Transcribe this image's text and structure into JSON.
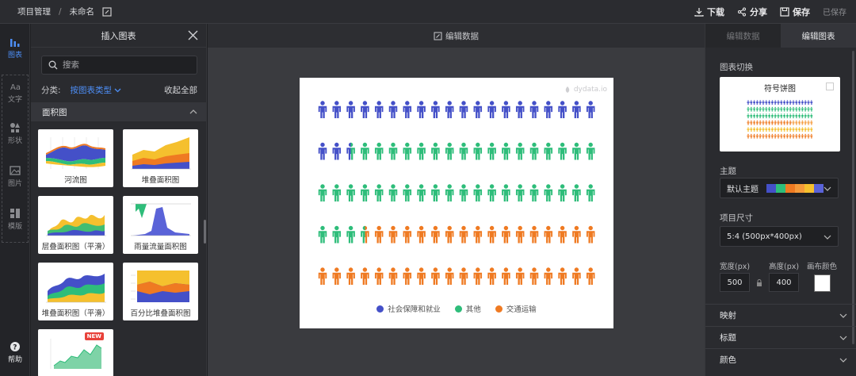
{
  "breadcrumb": {
    "project": "项目管理",
    "separator": "/",
    "name": "未命名"
  },
  "topbar": {
    "download": "下载",
    "share": "分享",
    "save": "保存",
    "saved_status": "已保存"
  },
  "rail": {
    "items": [
      "图表",
      "文字",
      "形状",
      "图片",
      "模版"
    ],
    "help": "帮助"
  },
  "insert_panel": {
    "title": "插入图表",
    "search_placeholder": "搜索",
    "filter_label": "分类:",
    "filter_value": "按图表类型",
    "collapse_all": "收起全部",
    "section": "面积图",
    "cards": [
      "河流图",
      "堆叠面积图",
      "层叠面积图（平滑）",
      "雨量流量面积图",
      "堆叠面积图（平滑）",
      "百分比堆叠面积图",
      ""
    ],
    "new_badge": "NEW"
  },
  "canvas": {
    "edit_data": "编辑数据",
    "watermark": "dydata.io"
  },
  "chart_data": {
    "type": "pictorial",
    "icon": "person-icon",
    "rows": 5,
    "icons_per_row": 20,
    "total_icons": 100,
    "series": [
      {
        "name": "社会保障和就业",
        "count": 22.5,
        "color": "#4450c8"
      },
      {
        "name": "其他",
        "count": 41,
        "color": "#2ebd7a"
      },
      {
        "name": "交通运输",
        "count": 36.5,
        "color": "#ef7a22"
      }
    ],
    "legend_position": "bottom"
  },
  "right_panel": {
    "tabs": [
      "编辑数据",
      "编辑图表"
    ],
    "active_tab": 1,
    "chart_switch_label": "图表切换",
    "chart_switch_name": "符号饼图",
    "theme_label": "主题",
    "theme_value": "默认主题",
    "theme_colors": [
      "#4450c8",
      "#2ebd7a",
      "#ef7a22",
      "#f59a3a",
      "#f5c02e",
      "#5a63d8"
    ],
    "size_label": "项目尺寸",
    "size_value": "5:4 (500px*400px)",
    "width_label": "宽度(px)",
    "height_label": "高度(px)",
    "canvas_color_label": "画布颜色",
    "width_value": "500",
    "height_value": "400",
    "canvas_color": "#ffffff",
    "accordions": [
      "映射",
      "标题",
      "颜色"
    ]
  }
}
